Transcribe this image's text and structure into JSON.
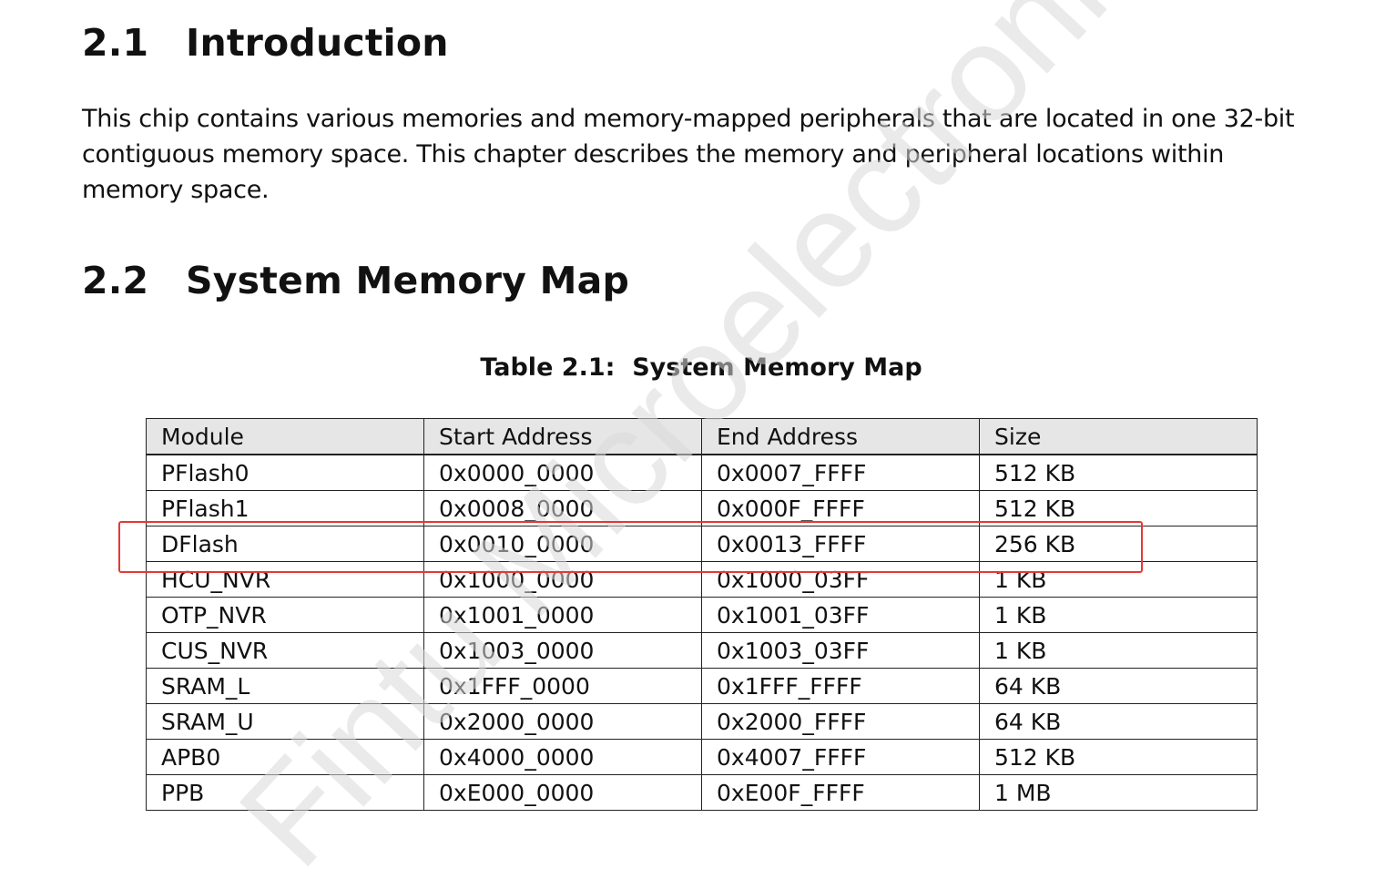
{
  "sections": [
    {
      "number": "2.1",
      "title": "Introduction"
    },
    {
      "number": "2.2",
      "title": "System Memory Map"
    }
  ],
  "intro_paragraph": "This chip contains various memories and memory-mapped peripherals that are located in one 32-bit contiguous memory space. This chapter describes the memory and peripheral locations within memory space.",
  "table": {
    "caption": "Table 2.1:  System Memory Map",
    "headers": [
      "Module",
      "Start Address",
      "End Address",
      "Size"
    ],
    "rows": [
      [
        "PFlash0",
        "0x0000_0000",
        "0x0007_FFFF",
        "512 KB"
      ],
      [
        "PFlash1",
        "0x0008_0000",
        "0x000F_FFFF",
        "512 KB"
      ],
      [
        "DFlash",
        "0x0010_0000",
        "0x0013_FFFF",
        "256 KB"
      ],
      [
        "HCU_NVR",
        "0x1000_0000",
        "0x1000_03FF",
        "1 KB"
      ],
      [
        "OTP_NVR",
        "0x1001_0000",
        "0x1001_03FF",
        "1 KB"
      ],
      [
        "CUS_NVR",
        "0x1003_0000",
        "0x1003_03FF",
        "1 KB"
      ],
      [
        "SRAM_L",
        "0x1FFF_0000",
        "0x1FFF_FFFF",
        "64 KB"
      ],
      [
        "SRAM_U",
        "0x2000_0000",
        "0x2000_FFFF",
        "64 KB"
      ],
      [
        "APB0",
        "0x4000_0000",
        "0x4007_FFFF",
        "512 KB"
      ],
      [
        "PPB",
        "0xE000_0000",
        "0xE00F_FFFF",
        "1 MB"
      ]
    ],
    "highlighted_row": 2
  },
  "watermark": {
    "text": "Fintu Microelectronics",
    "color": "#d9d9d9"
  },
  "colors": {
    "highlight": "#e53935",
    "header_bg": "#e6e6e6",
    "text": "#111111"
  }
}
